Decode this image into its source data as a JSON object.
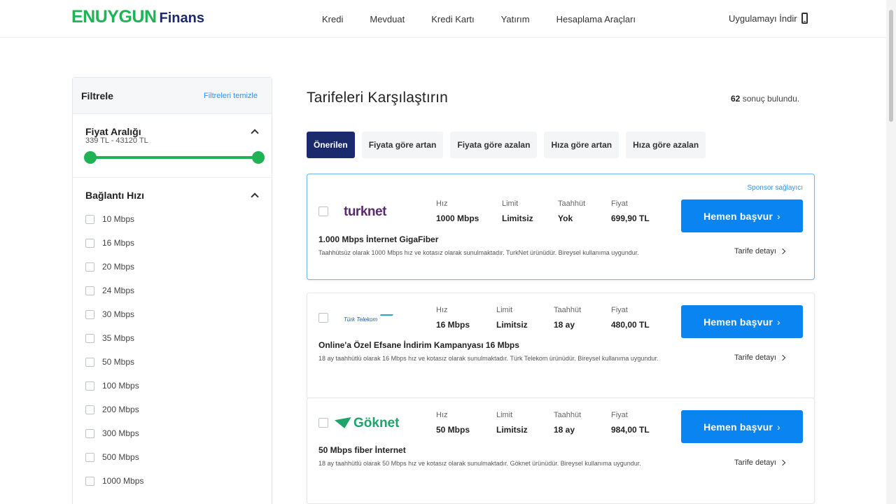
{
  "header": {
    "logo_main": "ENUYGUN",
    "logo_sub": "Finans",
    "nav": [
      "Kredi",
      "Mevduat",
      "Kredi Kartı",
      "Yatırım",
      "Hesaplama Araçları"
    ],
    "app_link": "Uygulamayı İndir"
  },
  "sidebar": {
    "title": "Filtrele",
    "clear": "Filtreleri temizle",
    "price_title": "Fiyat Aralığı",
    "price_range": "339 TL - 43120 TL",
    "speed_title": "Bağlantı Hızı",
    "speeds": [
      "10 Mbps",
      "16 Mbps",
      "20 Mbps",
      "24 Mbps",
      "30 Mbps",
      "35 Mbps",
      "50 Mbps",
      "100 Mbps",
      "200 Mbps",
      "300 Mbps",
      "500 Mbps",
      "1000 Mbps"
    ]
  },
  "main": {
    "title": "Tarifeleri Karşılaştırın",
    "result_count": "62",
    "result_suffix": "sonuç bulundu.",
    "sort_tabs": [
      "Önerilen",
      "Fiyata göre artan",
      "Fiyata göre azalan",
      "Hıza göre artan",
      "Hıza göre azalan"
    ],
    "labels": {
      "speed": "Hız",
      "limit": "Limit",
      "commitment": "Taahhüt",
      "price": "Fiyat"
    },
    "apply_label": "Hemen başvur",
    "detail_label": "Tarife detayı",
    "sponsor_label": "Sponsor sağlayıcı",
    "offers": [
      {
        "brand": "turknet",
        "speed": "1000 Mbps",
        "limit": "Limitsiz",
        "commitment": "Yok",
        "price": "699,90 TL",
        "title": "1.000 Mbps İnternet GigaFiber",
        "desc": "Taahhütsüz olarak 1000 Mbps hız ve kotasız olarak sunulmaktadır. TurkNet ürünüdür. Bireysel kullanıma uygundur."
      },
      {
        "brand": "Türk Telekom",
        "speed": "16 Mbps",
        "limit": "Limitsiz",
        "commitment": "18 ay",
        "price": "480,00 TL",
        "title": "Online'a Özel Efsane İndirim Kampanyası 16 Mbps",
        "desc": "18 ay taahhütlü olarak 16 Mbps hız ve kotasız olarak sunulmaktadır. Türk Telekom ürünüdür. Bireysel kullanıma uygundur."
      },
      {
        "brand": "Göknet",
        "speed": "50 Mbps",
        "limit": "Limitsiz",
        "commitment": "18 ay",
        "price": "984,00 TL",
        "title": "50 Mbps fiber İnternet",
        "desc": "18 ay taahhütlü olarak 50 Mbps hız ve kotasız olarak sunulmaktadır. Göknet ürünüdür. Bireysel kullanıma uygundur."
      }
    ]
  },
  "colors": {
    "brand_green": "#1fb356",
    "brand_navy": "#1a2a6c",
    "primary_blue": "#0a84f0"
  }
}
